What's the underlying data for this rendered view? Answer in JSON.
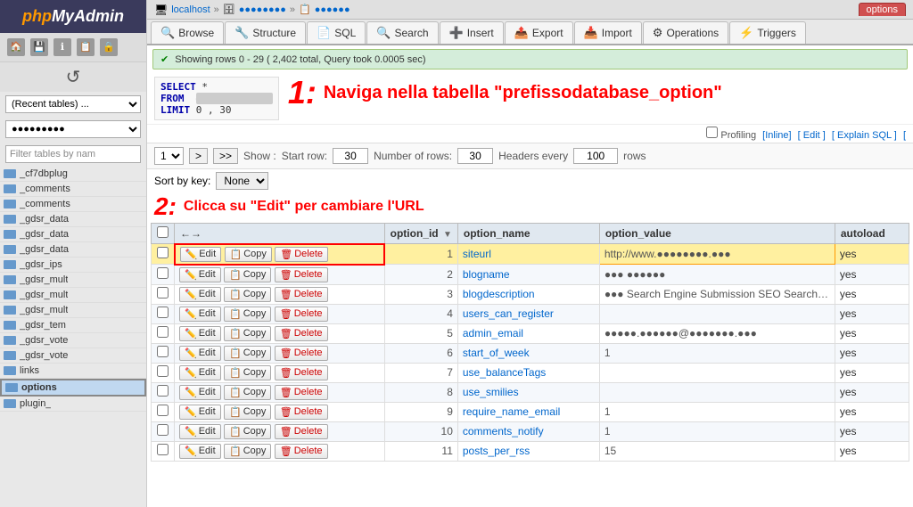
{
  "sidebar": {
    "logo": "phpMyAdmin",
    "logo_php": "php",
    "logo_mya": "MyAdmin",
    "icons": [
      "🏠",
      "💾",
      "🔑",
      "📋",
      "🔒"
    ],
    "reload_icon": "↺",
    "select1": "(Recent tables) ...",
    "select2": "",
    "filter_placeholder": "Filter tables by nam",
    "tables": [
      {
        "name": "_cf7dbplug",
        "active": false
      },
      {
        "name": "_comments",
        "active": false
      },
      {
        "name": "_comments",
        "active": false
      },
      {
        "name": "_gdsr_data",
        "active": false
      },
      {
        "name": "_gdsr_data",
        "active": false
      },
      {
        "name": "_gdsr_data",
        "active": false
      },
      {
        "name": "_gdsr_ips",
        "active": false
      },
      {
        "name": "_gdsr_mult",
        "active": false
      },
      {
        "name": "_gdsr_mult",
        "active": false
      },
      {
        "name": "_gdsr_mult",
        "active": false
      },
      {
        "name": "_gdsr_tem",
        "active": false
      },
      {
        "name": "_gdsr_vote",
        "active": false
      },
      {
        "name": "_gdsr_vote",
        "active": false
      },
      {
        "name": "links",
        "active": false
      },
      {
        "name": "options",
        "active": true
      },
      {
        "name": "plugin_",
        "active": false
      }
    ]
  },
  "breadcrumb": {
    "items": [
      "localhost",
      "●●●●●●●●",
      "●●●●●●"
    ],
    "active_tab": "options"
  },
  "nav_tabs": [
    {
      "icon": "🔍",
      "label": "Browse"
    },
    {
      "icon": "🔧",
      "label": "Structure"
    },
    {
      "icon": "📄",
      "label": "SQL"
    },
    {
      "icon": "🔍",
      "label": "Search"
    },
    {
      "icon": "➕",
      "label": "Insert"
    },
    {
      "icon": "📤",
      "label": "Export"
    },
    {
      "icon": "📥",
      "label": "Import"
    },
    {
      "icon": "⚙",
      "label": "Operations"
    },
    {
      "icon": "⚡",
      "label": "Triggers"
    }
  ],
  "status": {
    "message": "Showing rows 0 - 29  ( 2,402 total, Query took 0.0005 sec)"
  },
  "sql": {
    "line1": "SELECT  *",
    "line2": "FROM  ●●●●●●●●●●_●●●●●●",
    "line3": "LIMIT 0 , 30"
  },
  "annotation1": {
    "number": "1:",
    "text": "Naviga nella tabella \"prefissodatabase_option\""
  },
  "profiling": {
    "text": "Profiling",
    "links": [
      "[Inline]",
      "[ Edit ]",
      "[ Explain SQL ]",
      "["
    ]
  },
  "pagination": {
    "page": "1",
    "show_label": "Show :",
    "start_row_label": "Start row:",
    "start_row_value": "30",
    "num_rows_label": "Number of rows:",
    "num_rows_value": "30",
    "headers_label": "Headers every",
    "headers_value": "100",
    "rows_label": "rows"
  },
  "sort": {
    "label": "Sort by key:",
    "value": "None"
  },
  "annotation2": {
    "number": "2:",
    "text": "Clicca su \"Edit\" per cambiare l'URL"
  },
  "table": {
    "columns": [
      "",
      "",
      "option_id",
      "option_name",
      "option_value",
      "autoload"
    ],
    "rows": [
      {
        "id": 1,
        "name": "siteurl",
        "value": "http://www.●●●●●●●●.●●●",
        "autoload": "yes",
        "highlighted": true
      },
      {
        "id": 2,
        "name": "blogname",
        "value": "●●● ●●●●●●",
        "autoload": "yes",
        "highlighted": false
      },
      {
        "id": 3,
        "name": "blogdescription",
        "value": "●●● Search Engine Submission SEO Search Top",
        "autoload": "yes",
        "highlighted": false
      },
      {
        "id": 4,
        "name": "users_can_register",
        "value": "",
        "autoload": "yes",
        "highlighted": false
      },
      {
        "id": 5,
        "name": "admin_email",
        "value": "●●●●●.●●●●●●@●●●●●●●.●●●",
        "autoload": "yes",
        "highlighted": false
      },
      {
        "id": 6,
        "name": "start_of_week",
        "value": "1",
        "autoload": "yes",
        "highlighted": false
      },
      {
        "id": 7,
        "name": "use_balanceTags",
        "value": "",
        "autoload": "yes",
        "highlighted": false
      },
      {
        "id": 8,
        "name": "use_smilies",
        "value": "",
        "autoload": "yes",
        "highlighted": false
      },
      {
        "id": 9,
        "name": "require_name_email",
        "value": "1",
        "autoload": "yes",
        "highlighted": false
      },
      {
        "id": 10,
        "name": "comments_notify",
        "value": "1",
        "autoload": "yes",
        "highlighted": false
      },
      {
        "id": 11,
        "name": "posts_per_rss",
        "value": "15",
        "autoload": "yes",
        "highlighted": false
      }
    ]
  },
  "buttons": {
    "edit": "Edit",
    "copy": "Copy",
    "delete": "Delete"
  }
}
